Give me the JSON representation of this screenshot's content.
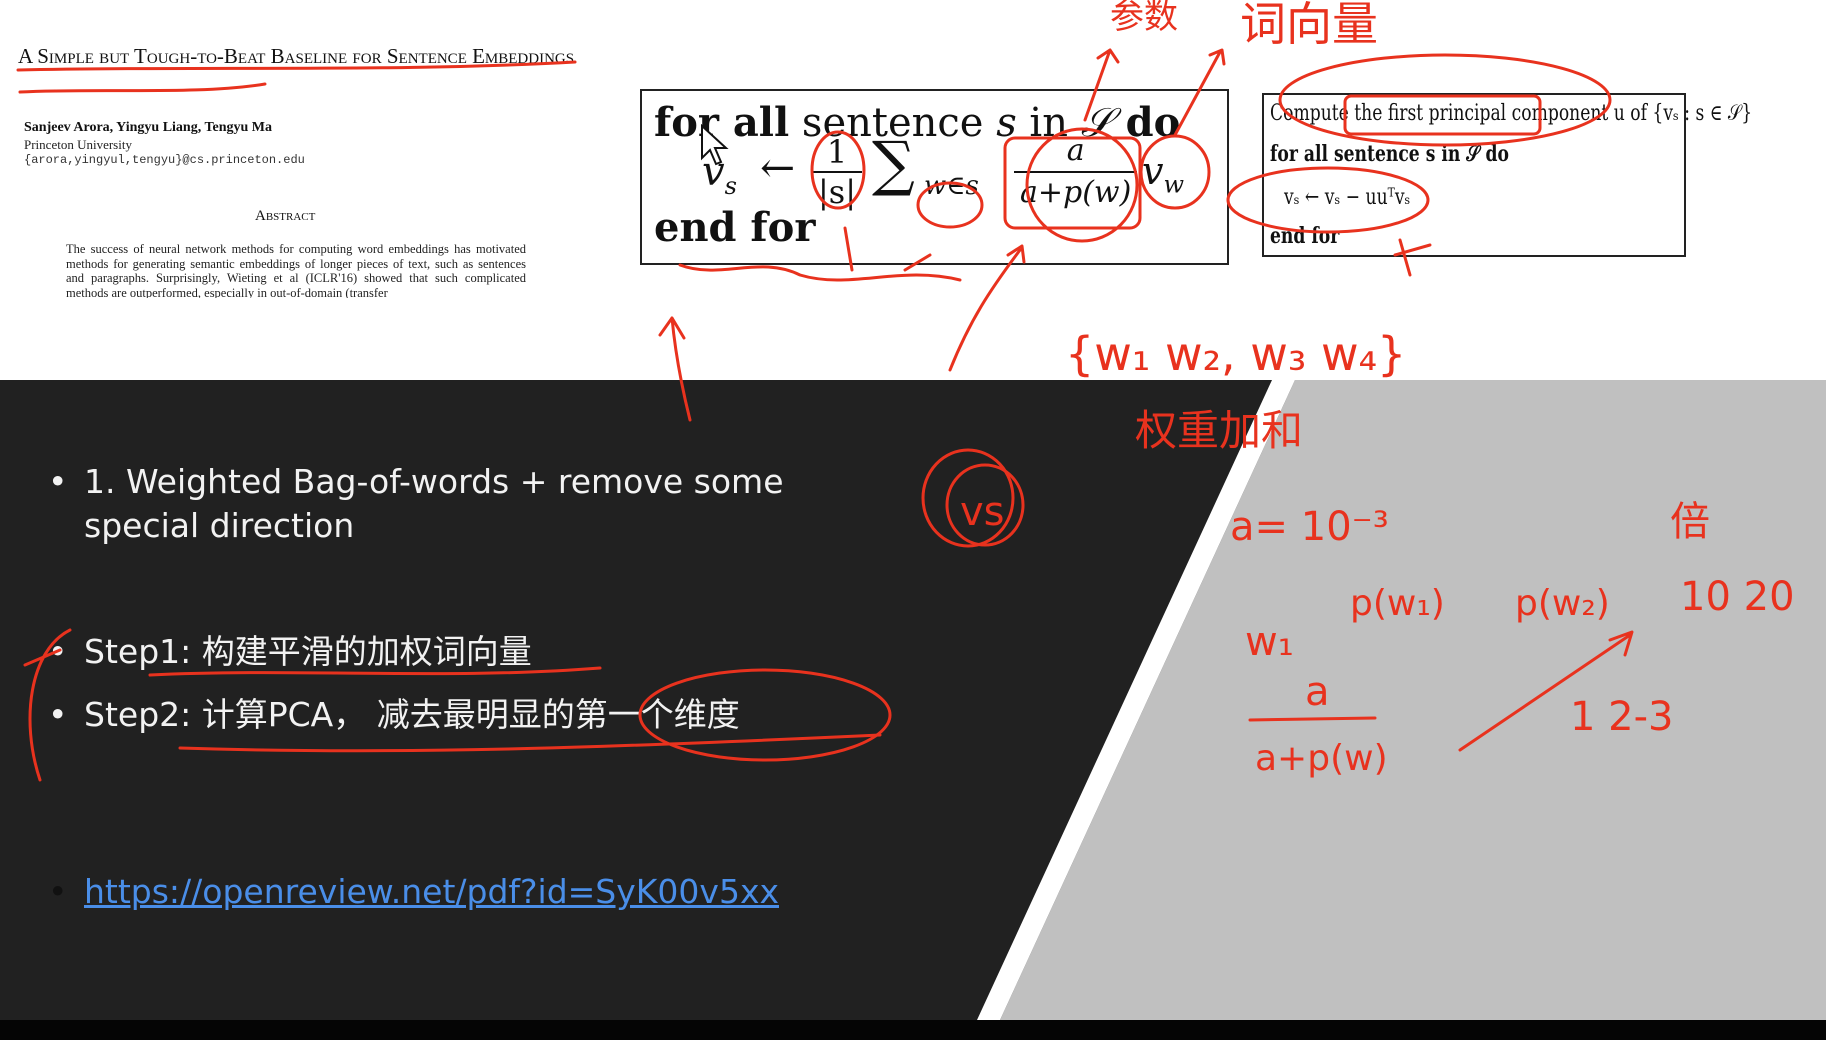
{
  "paper": {
    "title": "A Simple but Tough-to-Beat Baseline for Sentence Embeddings",
    "authors": "Sanjeev Arora, Yingyu Liang, Tengyu Ma",
    "affiliation": "Princeton University",
    "email": "{arora,yingyul,tengyu}@cs.princeton.edu",
    "abstract_heading": "Abstract",
    "abstract_text": "The success of neural network methods for computing word embeddings has motivated methods for generating semantic embeddings of longer pieces of text, such as sentences and paragraphs. Surprisingly, Wieting et al (ICLR'16) showed that such complicated methods are outperformed, especially in out-of-domain (transfer"
  },
  "algorithm1": {
    "for_kw": "for all",
    "sentence_text": " sentence ",
    "s_var": "s",
    "in_text": " in ",
    "S_set": "𝒮",
    "do_kw": " do",
    "vs": "v",
    "vs_sub": "s",
    "arrow": "←",
    "frac1_num": "1",
    "frac1_den": "|s|",
    "sum": "∑",
    "sum_sub": "w∈s",
    "frac2_num": "a",
    "frac2_den": "a+p(w)",
    "vw": "v",
    "vw_sub": "w",
    "end_kw": "end for"
  },
  "algorithm2": {
    "line1": "Compute the first principal component u of {vₛ : s ∈ 𝒮}",
    "line2": "for all sentence s in 𝒮 do",
    "line3": "vₛ ← vₛ − uuᵀvₛ",
    "line4": "end for"
  },
  "slide": {
    "bullet1": "1. Weighted Bag-of-words + remove some special direction",
    "bullet2": "Step1: 构建平滑的加权词向量",
    "bullet3": "Step2: 计算PCA， 减去最明显的第一个维度",
    "link": "https://openreview.net/pdf?id=SyK00v5xx"
  },
  "colors": {
    "slide_bg": "#212121",
    "gray_panel": "#c0c0c0",
    "annotation": "#e8321e",
    "link": "#4a8ee8"
  }
}
